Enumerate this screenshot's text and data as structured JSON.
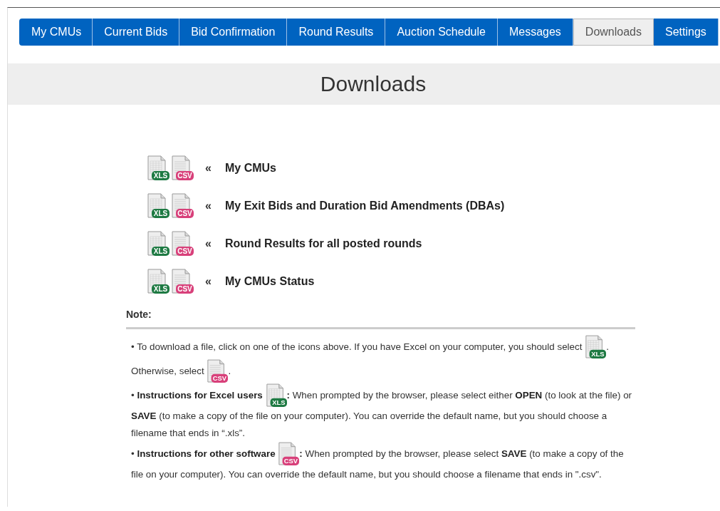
{
  "tabs": [
    {
      "label": "My CMUs",
      "selected": false
    },
    {
      "label": "Current Bids",
      "selected": false
    },
    {
      "label": "Bid Confirmation",
      "selected": false
    },
    {
      "label": "Round Results",
      "selected": false
    },
    {
      "label": "Auction Schedule",
      "selected": false
    },
    {
      "label": "Messages",
      "selected": false
    },
    {
      "label": "Downloads",
      "selected": true
    },
    {
      "label": "Settings",
      "selected": false
    }
  ],
  "page_title": "Downloads",
  "downloads": [
    {
      "arrow": "«",
      "label": "My CMUs",
      "icons": [
        {
          "kind": "xls",
          "badge": "XLS"
        },
        {
          "kind": "csv",
          "badge": "CSV"
        }
      ]
    },
    {
      "arrow": "«",
      "label": "My Exit Bids and Duration Bid Amendments (DBAs)",
      "icons": [
        {
          "kind": "xls",
          "badge": "XLS"
        },
        {
          "kind": "csv",
          "badge": "CSV"
        }
      ]
    },
    {
      "arrow": "«",
      "label": "Round Results for all posted rounds",
      "icons": [
        {
          "kind": "xls",
          "badge": "XLS"
        },
        {
          "kind": "csv",
          "badge": "CSV"
        }
      ]
    },
    {
      "arrow": "«",
      "label": "My CMUs Status",
      "icons": [
        {
          "kind": "xls",
          "badge": "XLS"
        },
        {
          "kind": "csv",
          "badge": "CSV"
        }
      ]
    }
  ],
  "note": {
    "heading": "Note:",
    "items": [
      {
        "parts": [
          {
            "kind": "text",
            "text": "• To download a file, click on one of the icons above. If you have Excel on your computer, you should select "
          },
          {
            "kind": "icon",
            "icon": {
              "kind": "xls",
              "badge": "XLS"
            }
          },
          {
            "kind": "text",
            "text": ". Otherwise, select "
          },
          {
            "kind": "icon",
            "icon": {
              "kind": "csv",
              "badge": "CSV"
            }
          },
          {
            "kind": "text",
            "text": "."
          }
        ]
      },
      {
        "parts": [
          {
            "kind": "text",
            "text": "• **Instructions for Excel users** "
          },
          {
            "kind": "icon",
            "icon": {
              "kind": "xls",
              "badge": "XLS"
            }
          },
          {
            "kind": "text",
            "text": "**:** When prompted by the browser, please select either **OPEN** (to look at the file) or **SAVE** (to make a copy of the file on your computer). You can override the default name, but you should choose a filename that ends in “.xls”."
          }
        ]
      },
      {
        "parts": [
          {
            "kind": "text",
            "text": "• **Instructions for other software** "
          },
          {
            "kind": "icon",
            "icon": {
              "kind": "csv",
              "badge": "CSV"
            }
          },
          {
            "kind": "text",
            "text": "**:** When prompted by the browser, please select **SAVE** (to make a copy of the file on your computer). You can override the default name, but you should choose a filename that ends in \".csv\"."
          }
        ]
      }
    ]
  }
}
